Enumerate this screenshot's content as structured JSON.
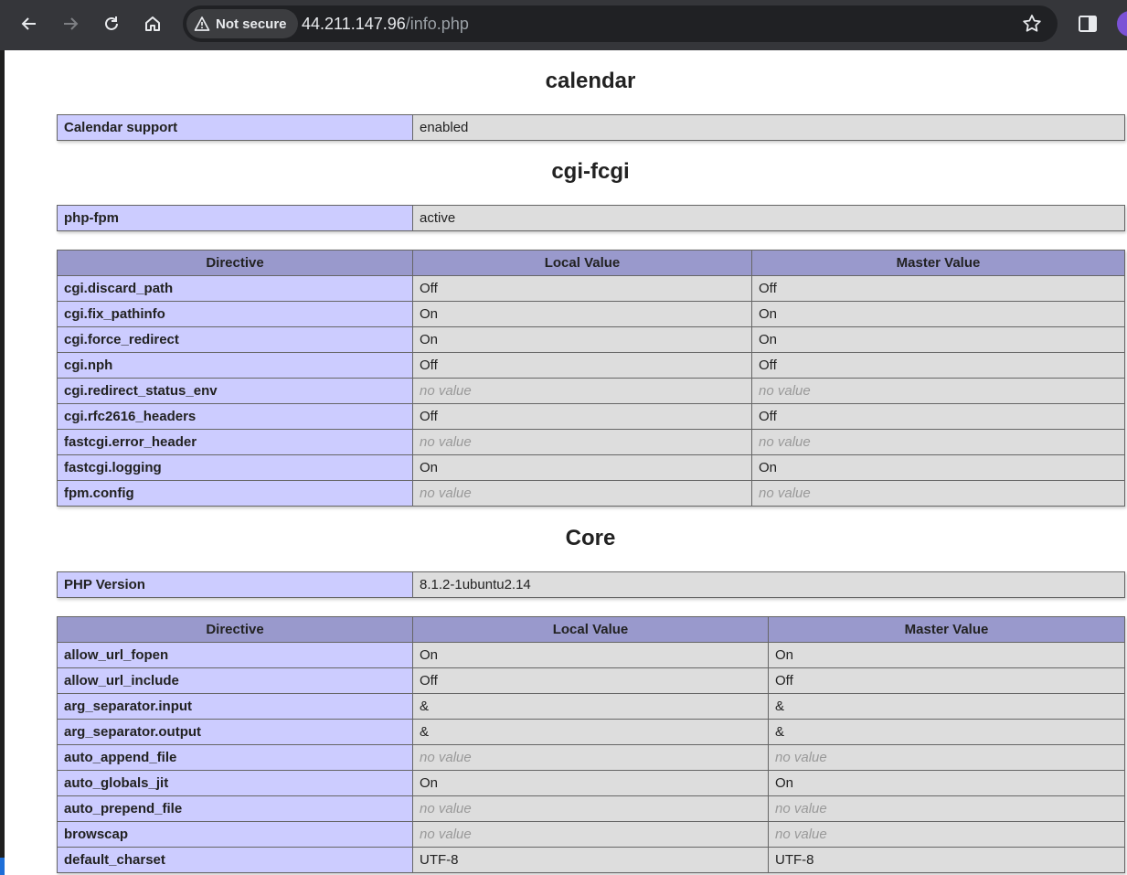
{
  "browser": {
    "security_label": "Not secure",
    "url_host": "44.211.147.96",
    "url_path": "/info.php",
    "icons": [
      "back-icon",
      "forward-icon",
      "reload-icon",
      "home-icon",
      "warning-icon",
      "star-icon",
      "side-panel-icon",
      "profile-avatar"
    ]
  },
  "sections": {
    "calendar": {
      "title": "calendar",
      "info": {
        "key": "Calendar support",
        "value": "enabled"
      }
    },
    "cgi": {
      "title": "cgi-fcgi",
      "info": {
        "key": "php-fpm",
        "value": "active"
      },
      "headers": [
        "Directive",
        "Local Value",
        "Master Value"
      ],
      "rows": [
        {
          "directive": "cgi.discard_path",
          "local": "Off",
          "master": "Off"
        },
        {
          "directive": "cgi.fix_pathinfo",
          "local": "On",
          "master": "On"
        },
        {
          "directive": "cgi.force_redirect",
          "local": "On",
          "master": "On"
        },
        {
          "directive": "cgi.nph",
          "local": "Off",
          "master": "Off"
        },
        {
          "directive": "cgi.redirect_status_env",
          "local": "no value",
          "master": "no value"
        },
        {
          "directive": "cgi.rfc2616_headers",
          "local": "Off",
          "master": "Off"
        },
        {
          "directive": "fastcgi.error_header",
          "local": "no value",
          "master": "no value"
        },
        {
          "directive": "fastcgi.logging",
          "local": "On",
          "master": "On"
        },
        {
          "directive": "fpm.config",
          "local": "no value",
          "master": "no value"
        }
      ]
    },
    "core": {
      "title": "Core",
      "info": {
        "key": "PHP Version",
        "value": "8.1.2-1ubuntu2.14"
      },
      "headers": [
        "Directive",
        "Local Value",
        "Master Value"
      ],
      "rows": [
        {
          "directive": "allow_url_fopen",
          "local": "On",
          "master": "On"
        },
        {
          "directive": "allow_url_include",
          "local": "Off",
          "master": "Off"
        },
        {
          "directive": "arg_separator.input",
          "local": "&",
          "master": "&"
        },
        {
          "directive": "arg_separator.output",
          "local": "&",
          "master": "&"
        },
        {
          "directive": "auto_append_file",
          "local": "no value",
          "master": "no value"
        },
        {
          "directive": "auto_globals_jit",
          "local": "On",
          "master": "On"
        },
        {
          "directive": "auto_prepend_file",
          "local": "no value",
          "master": "no value"
        },
        {
          "directive": "browscap",
          "local": "no value",
          "master": "no value"
        },
        {
          "directive": "default_charset",
          "local": "UTF-8",
          "master": "UTF-8"
        }
      ]
    }
  }
}
